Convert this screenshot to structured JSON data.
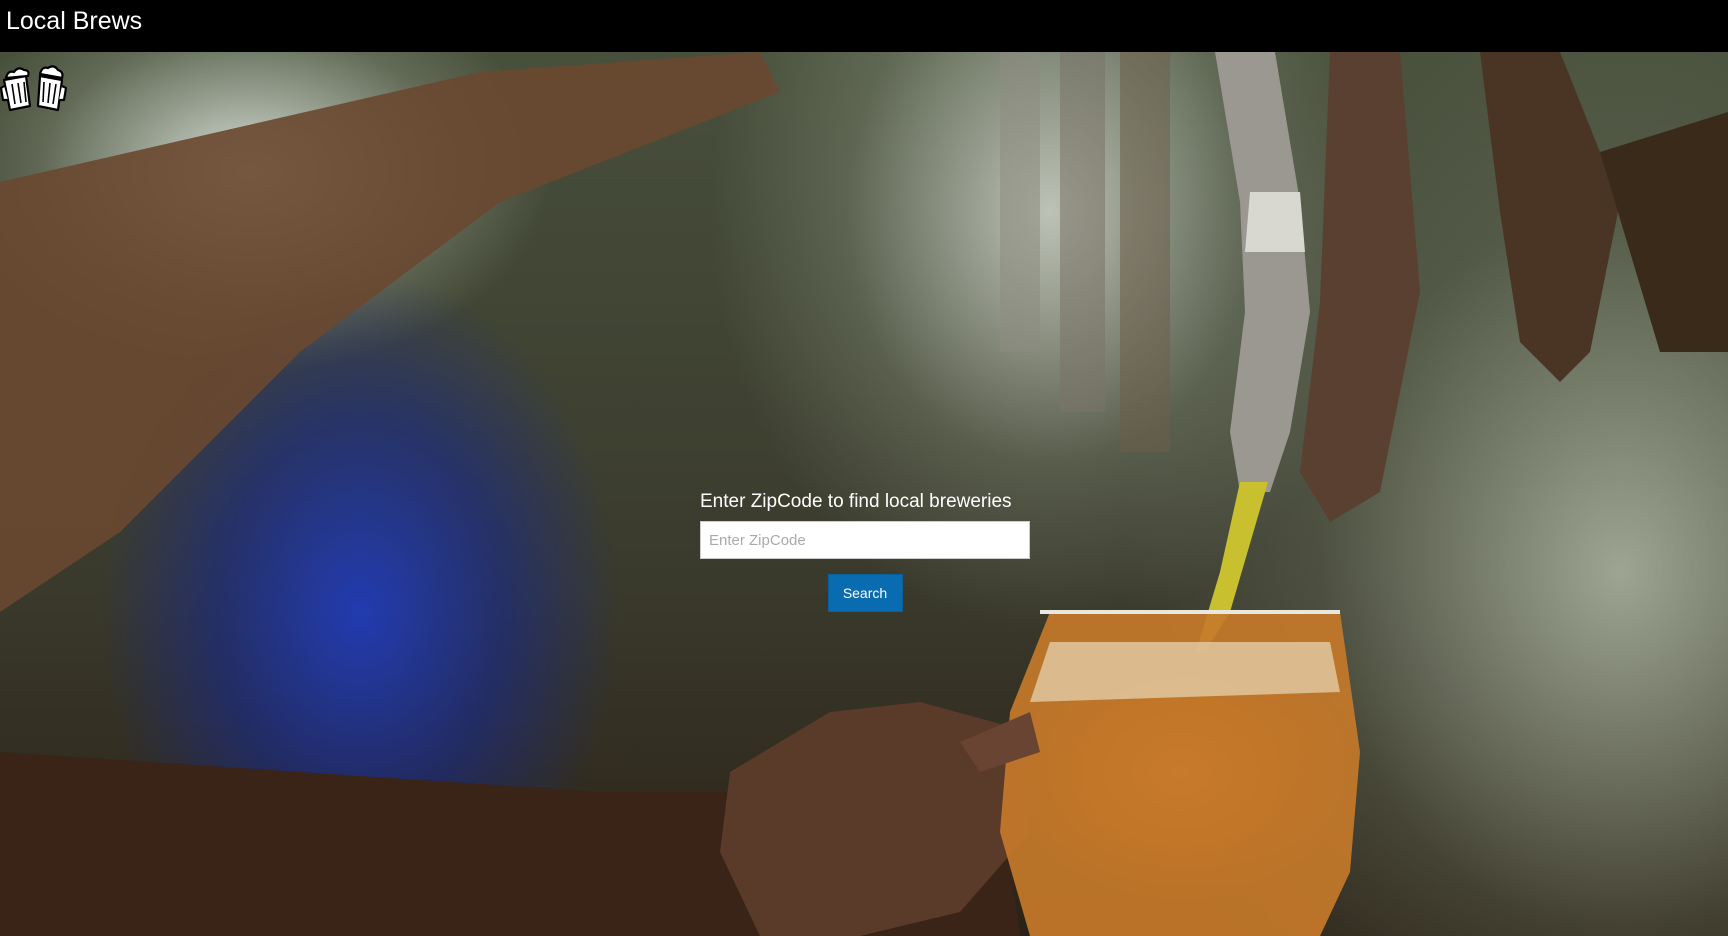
{
  "header": {
    "title": "Local Brews",
    "background": "#000000"
  },
  "logo": {
    "icon": "beer-mugs-icon"
  },
  "hero": {
    "background_image": "bartender-pouring-beer-photo"
  },
  "search": {
    "heading": "Enter ZipCode to find local breweries",
    "placeholder": "Enter ZipCode",
    "value": "",
    "button_label": "Search",
    "button_color": "#0a6cb0"
  }
}
